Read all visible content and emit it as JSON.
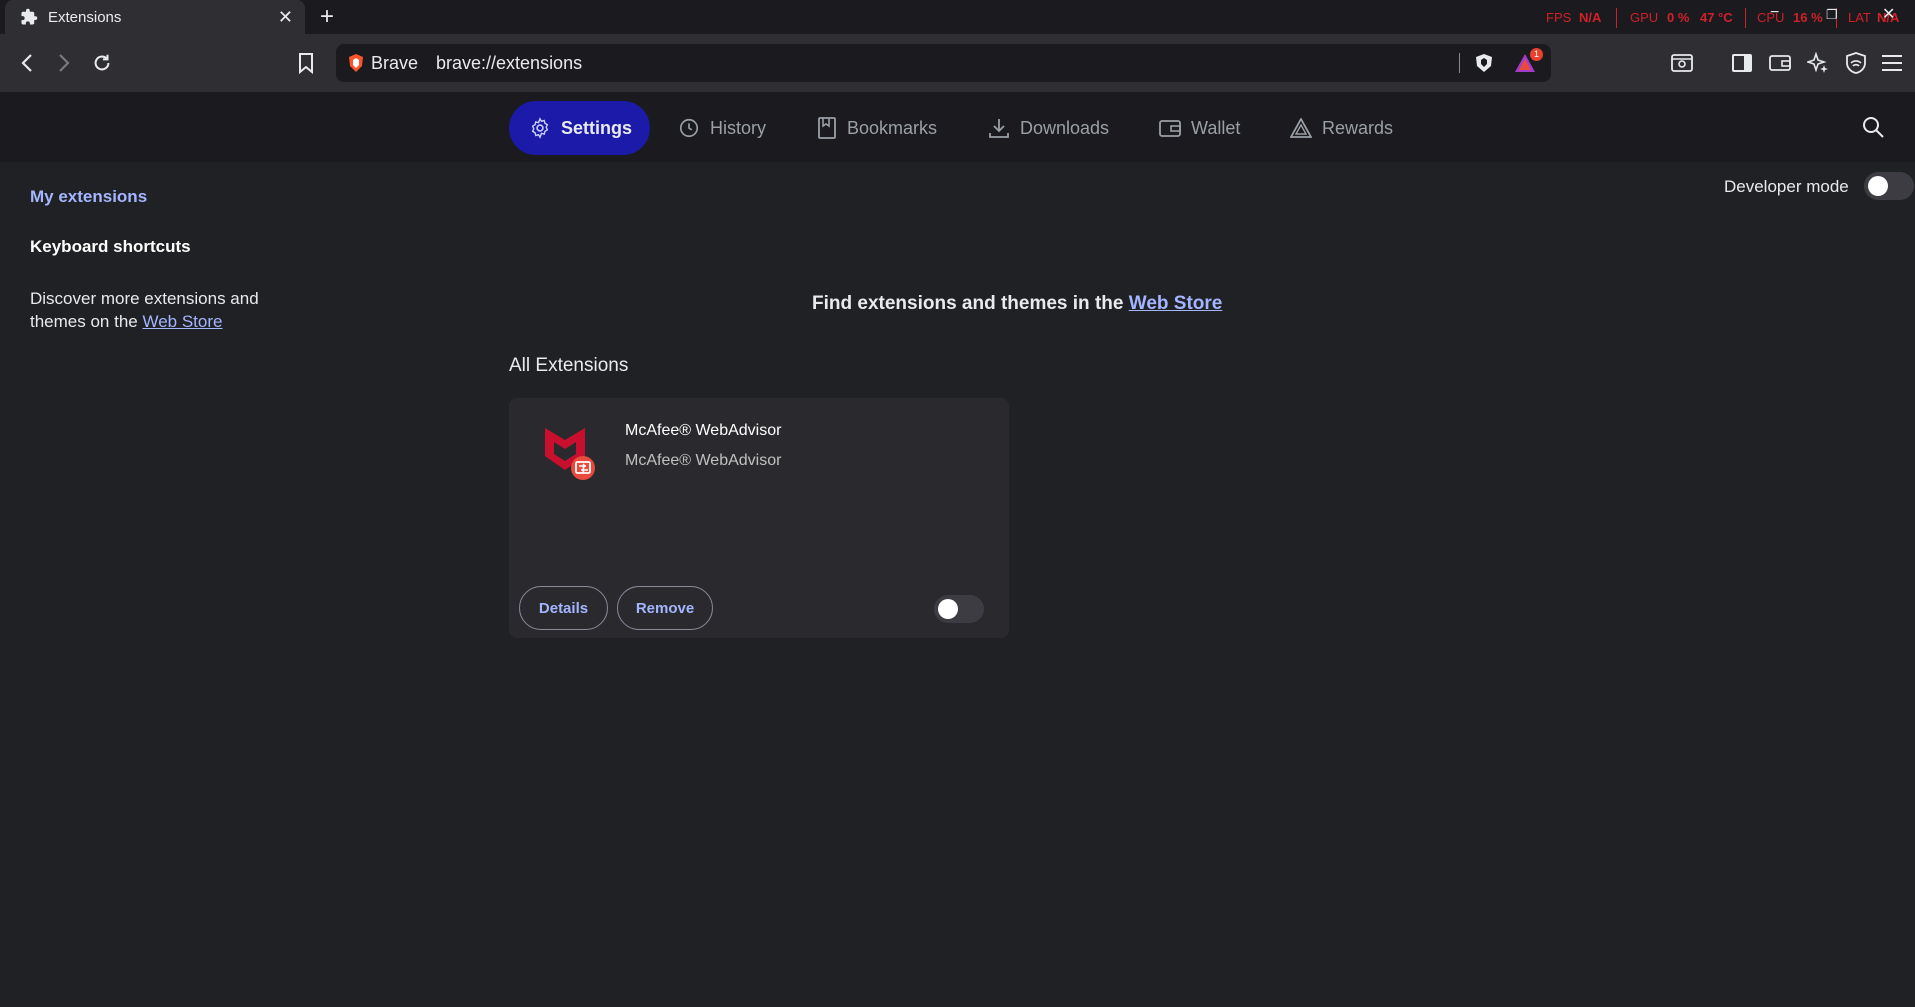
{
  "tab": {
    "title": "Extensions"
  },
  "overlay": {
    "fps_label": "FPS",
    "fps_value": "N/A",
    "gpu_label": "GPU",
    "gpu_value": "0 %",
    "gpu_temp": "47 °C",
    "cpu_label": "CPU",
    "cpu_value": "16 %",
    "lat_label": "LAT",
    "lat_value": "N/A"
  },
  "omnibox": {
    "site": "Brave",
    "url": "brave://extensions",
    "notification_count": "1"
  },
  "nav": {
    "tabs": [
      {
        "label": "Settings",
        "active": true
      },
      {
        "label": "History"
      },
      {
        "label": "Bookmarks"
      },
      {
        "label": "Downloads"
      },
      {
        "label": "Wallet"
      },
      {
        "label": "Rewards"
      }
    ]
  },
  "sidebar": {
    "items": [
      {
        "label": "My extensions"
      },
      {
        "label": "Keyboard shortcuts"
      }
    ],
    "discover_text": "Discover more extensions and themes on the ",
    "discover_link": "Web Store"
  },
  "main": {
    "developer_mode_label": "Developer mode",
    "developer_mode_on": false,
    "store_text": "Find extensions and themes in the ",
    "store_link": "Web Store",
    "section_title": "All Extensions",
    "extensions": [
      {
        "name": "McAfee® WebAdvisor",
        "description": "McAfee® WebAdvisor",
        "details_label": "Details",
        "remove_label": "Remove",
        "enabled": false
      }
    ]
  },
  "colors": {
    "accent": "#a4b5ff",
    "active_tab": "#1c1aa8",
    "background": "#202124",
    "mcafee_red": "#c8102e",
    "overlay_red": "#d0202a"
  }
}
